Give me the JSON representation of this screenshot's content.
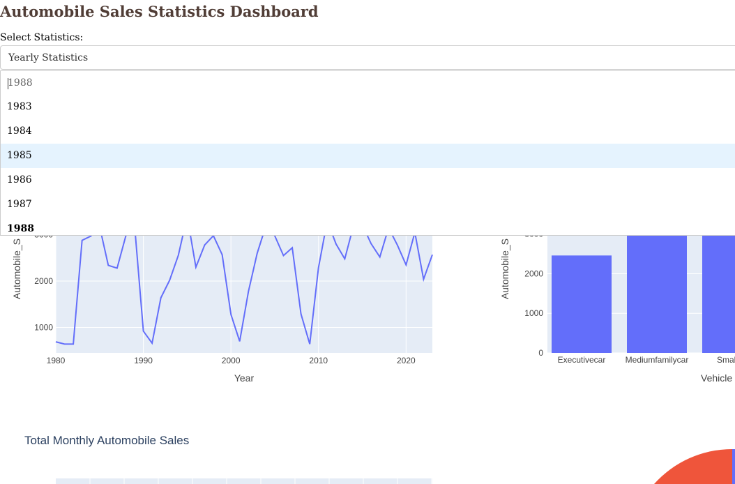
{
  "page": {
    "title": "Automobile Sales Statistics Dashboard",
    "select_label": "Select Statistics:"
  },
  "stats_dropdown": {
    "selected": "Yearly Statistics"
  },
  "year_dropdown": {
    "search_value": "1988",
    "options": [
      "1983",
      "1984",
      "1985",
      "1986",
      "1987",
      "1988"
    ],
    "hovered": "1985",
    "selected": "1988"
  },
  "colors": {
    "line": "#636efa",
    "bar": "#636efa",
    "plot_bg": "#e5ecf6",
    "pie": "#ef553b"
  },
  "chart_data": [
    {
      "type": "line",
      "xlabel": "Year",
      "ylabel": "Automobile_S",
      "x_ticks": [
        "1980",
        "1990",
        "2000",
        "2010",
        "2020"
      ],
      "y_ticks": [
        "1000",
        "2000",
        "3000"
      ],
      "x_range": [
        1980,
        2023
      ],
      "y_range": [
        450,
        3100
      ],
      "x": [
        1980,
        1981,
        1982,
        1983,
        1984,
        1985,
        1986,
        1987,
        1988,
        1989,
        1990,
        1991,
        1992,
        1993,
        1994,
        1995,
        1996,
        1997,
        1998,
        1999,
        2000,
        2001,
        2002,
        2003,
        2004,
        2005,
        2006,
        2007,
        2008,
        2009,
        2010,
        2011,
        2012,
        2013,
        2014,
        2015,
        2016,
        2017,
        2018,
        2019,
        2020,
        2021,
        2022,
        2023
      ],
      "y": [
        690,
        640,
        640,
        2880,
        2970,
        3180,
        2340,
        2280,
        2980,
        3200,
        920,
        660,
        1640,
        2020,
        2560,
        3400,
        2300,
        2780,
        2980,
        2570,
        1280,
        700,
        1780,
        2600,
        3200,
        2980,
        2550,
        2720,
        1290,
        640,
        2290,
        3300,
        2800,
        2480,
        3200,
        3220,
        2810,
        2520,
        3150,
        2780,
        2350,
        3050,
        2040,
        2570
      ]
    },
    {
      "type": "bar",
      "xlabel": "Vehicle",
      "ylabel": "Automobile_S",
      "y_ticks": [
        "0",
        "1000",
        "2000",
        "3000"
      ],
      "y_range": [
        0,
        3100
      ],
      "categories": [
        "Executivecar",
        "Mediumfamilycar",
        "Smallfar"
      ],
      "values": [
        2460,
        3600,
        3600
      ]
    },
    {
      "type": "bar",
      "title": "Total Monthly Automobile Sales"
    }
  ]
}
